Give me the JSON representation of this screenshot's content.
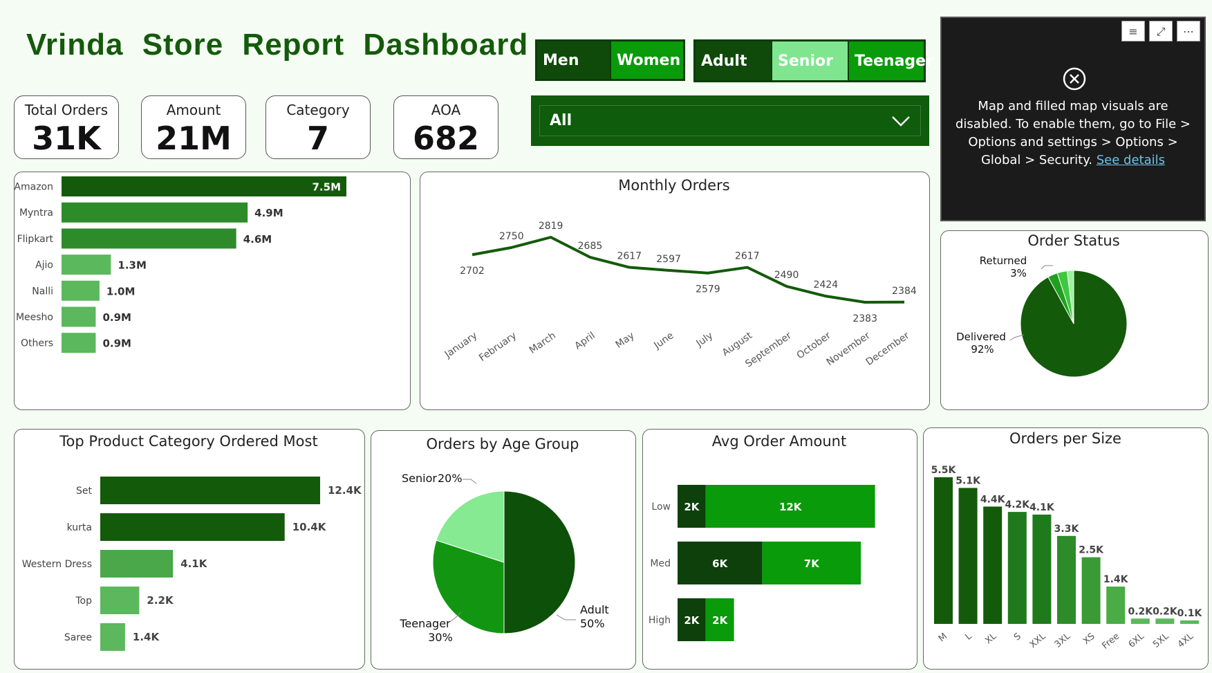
{
  "header": {
    "title": "Vrinda  Store  Report  Dashboard"
  },
  "kpis": [
    {
      "label": "Total Orders",
      "value": "31K"
    },
    {
      "label": "Amount",
      "value": "21M"
    },
    {
      "label": "Category",
      "value": "7"
    },
    {
      "label": "AOA",
      "value": "682"
    }
  ],
  "gender_slicer": [
    "Men",
    "Women"
  ],
  "age_slicer": [
    "Adult",
    "Senior",
    "Teenager"
  ],
  "dropdown": {
    "value": "All"
  },
  "map_notice": {
    "text": "Map and filled map visuals are disabled. To enable them, go to File > Options and settings > Options > Global > Security.",
    "link": "See details"
  },
  "colors": {
    "dark": "#145a0b",
    "mid": "#2e8b2a",
    "light": "#5cb85c",
    "lighter": "#7fe68f",
    "bright": "#0a9b0a",
    "darkest": "#0d400a"
  },
  "chart_data": [
    {
      "type": "bar",
      "id": "channels",
      "categories": [
        "Amazon",
        "Myntra",
        "Flipkart",
        "Ajio",
        "Nalli",
        "Meesho",
        "Others"
      ],
      "values": [
        7.5,
        4.9,
        4.6,
        1.3,
        1.0,
        0.9,
        0.9
      ],
      "labels": [
        "7.5M",
        "4.9M",
        "4.6M",
        "1.3M",
        "1.0M",
        "0.9M",
        "0.9M"
      ],
      "orientation": "horizontal"
    },
    {
      "type": "line",
      "id": "monthly",
      "title": "Monthly Orders",
      "categories": [
        "January",
        "February",
        "March",
        "April",
        "May",
        "June",
        "July",
        "August",
        "September",
        "October",
        "November",
        "December"
      ],
      "values": [
        2702,
        2750,
        2819,
        2685,
        2617,
        2597,
        2579,
        2617,
        2490,
        2424,
        2383,
        2384
      ]
    },
    {
      "type": "pie",
      "id": "status",
      "title": "Order Status",
      "slices": [
        {
          "name": "Delivered",
          "value": 92,
          "label": "92%"
        },
        {
          "name": "Returned",
          "value": 3,
          "label": "3%"
        },
        {
          "name": "",
          "value": 3,
          "label": ""
        },
        {
          "name": "",
          "value": 2,
          "label": ""
        }
      ]
    },
    {
      "type": "bar",
      "id": "category",
      "title": "Top Product Category Ordered Most",
      "categories": [
        "Set",
        "kurta",
        "Western Dress",
        "Top",
        "Saree"
      ],
      "values": [
        12.4,
        10.4,
        4.1,
        2.2,
        1.4
      ],
      "labels": [
        "12.4K",
        "10.4K",
        "4.1K",
        "2.2K",
        "1.4K"
      ],
      "orientation": "horizontal"
    },
    {
      "type": "pie",
      "id": "age",
      "title": "Orders by Age Group",
      "slices": [
        {
          "name": "Adult",
          "value": 50,
          "label": "50%"
        },
        {
          "name": "Teenager",
          "value": 30,
          "label": "30%"
        },
        {
          "name": "Senior",
          "value": 20,
          "label": "20%"
        }
      ]
    },
    {
      "type": "bar",
      "id": "avg",
      "title": "Avg Order Amount",
      "categories": [
        "Low",
        "Med",
        "High"
      ],
      "series": [
        {
          "values": [
            2,
            6,
            2
          ],
          "labels": [
            "2K",
            "6K",
            "2K"
          ]
        },
        {
          "values": [
            12,
            7,
            2
          ],
          "labels": [
            "12K",
            "7K",
            "2K"
          ]
        }
      ],
      "orientation": "horizontal",
      "stacked": true
    },
    {
      "type": "bar",
      "id": "size",
      "title": "Orders per Size",
      "categories": [
        "M",
        "L",
        "XL",
        "S",
        "XXL",
        "3XL",
        "XS",
        "Free",
        "6XL",
        "5XL",
        "4XL"
      ],
      "values": [
        5.5,
        5.1,
        4.4,
        4.2,
        4.1,
        3.3,
        2.5,
        1.4,
        0.2,
        0.2,
        0.1
      ],
      "labels": [
        "5.5K",
        "5.1K",
        "4.4K",
        "4.2K",
        "4.1K",
        "3.3K",
        "2.5K",
        "1.4K",
        "0.2K",
        "0.2K",
        "0.1K"
      ]
    }
  ]
}
